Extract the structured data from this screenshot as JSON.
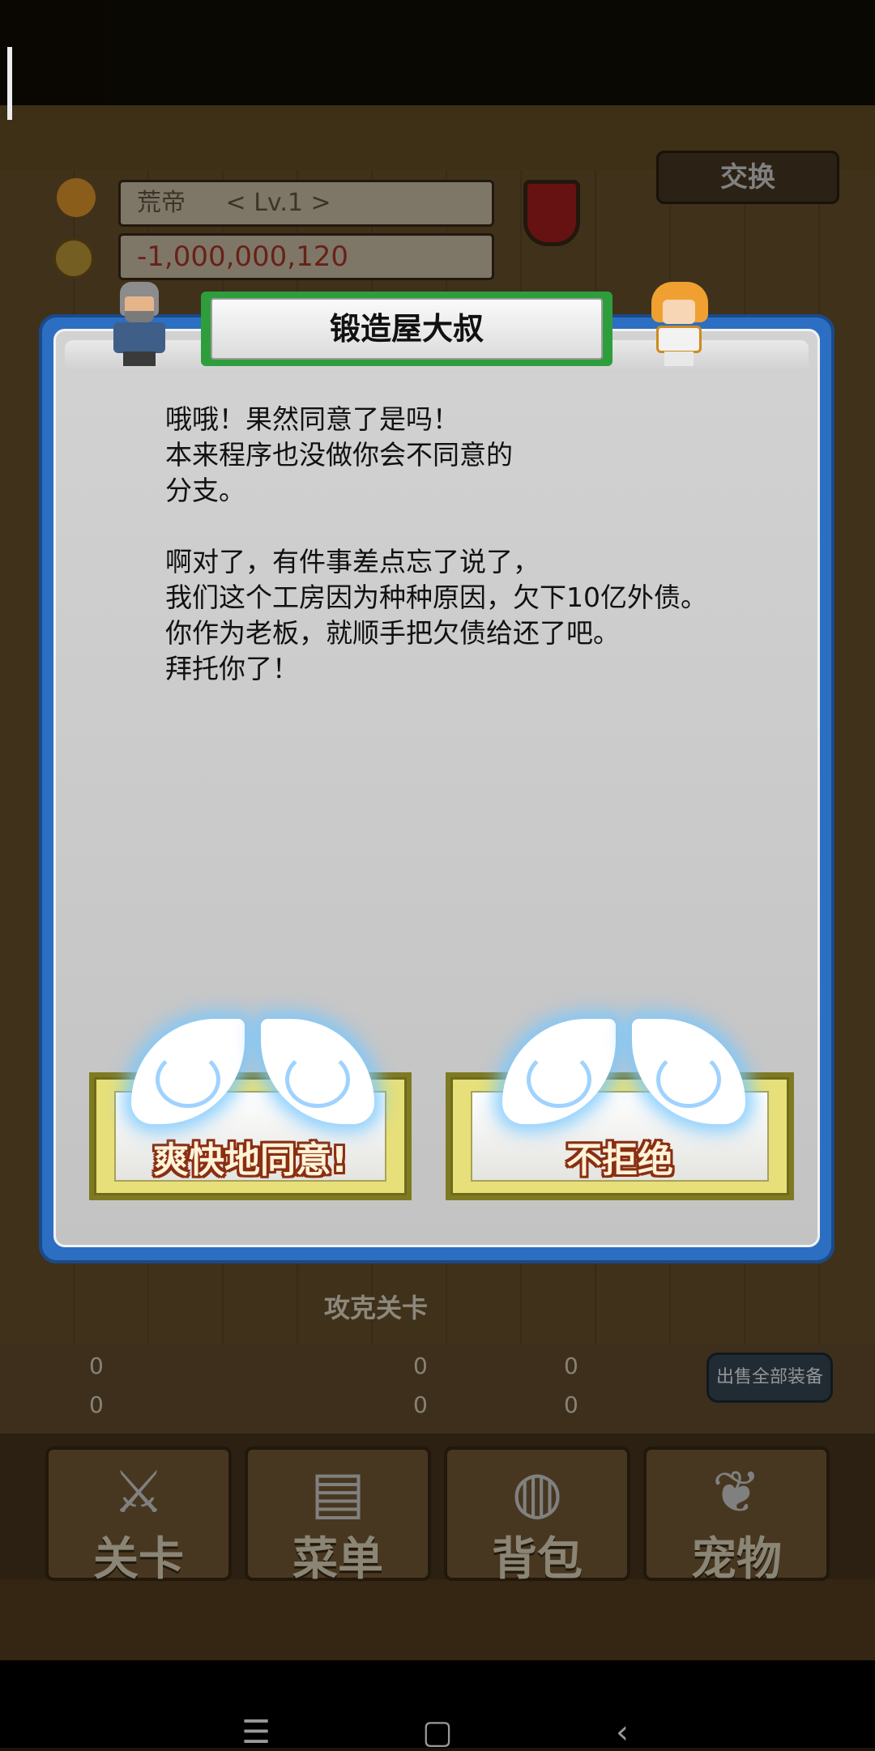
{
  "player": {
    "name": "荒帝",
    "level": "< Lv.1 >",
    "gold": "-1,000,000,120"
  },
  "background": {
    "exchange_button": "交换",
    "fight_label": "攻克关卡",
    "sell_all_button": "出售全部装备",
    "stats": [
      "0",
      "0",
      "0",
      "0",
      "0",
      "0"
    ],
    "nav": [
      {
        "label": "关卡",
        "icon": "crossed-swords-icon"
      },
      {
        "label": "菜单",
        "icon": "book-icon"
      },
      {
        "label": "背包",
        "icon": "backpack-icon"
      },
      {
        "label": "宠物",
        "icon": "pet-icon"
      }
    ]
  },
  "dialog": {
    "speaker": "锻造屋大叔",
    "paragraph_1": "哦哦！果然同意了是吗！\n本来程序也没做你会不同意的\n分支。",
    "paragraph_2": "啊对了，有件事差点忘了说了，\n我们这个工房因为种种原因，欠下10亿外债。\n你作为老板，就顺手把欠债给还了吧。\n拜托你了！",
    "options": [
      {
        "label": "爽快地同意!"
      },
      {
        "label": "不拒绝"
      }
    ]
  },
  "system_nav": {
    "menu": "☰",
    "home": "▢",
    "back": "‹"
  },
  "colors": {
    "dialog_border": "#2c6fc2",
    "title_plate": "#2e9e3c",
    "option_text_outline": "#8a2e12"
  }
}
